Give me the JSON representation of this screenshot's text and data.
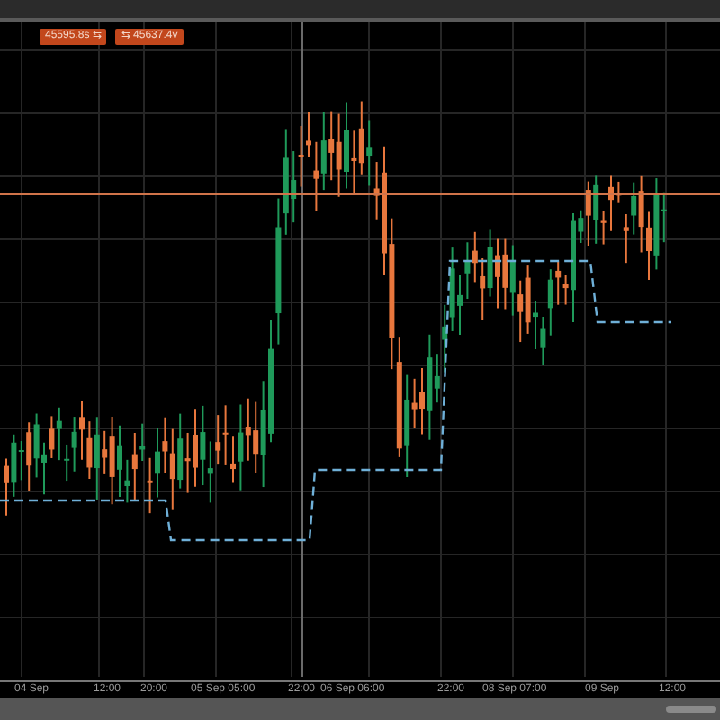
{
  "price_tags": [
    {
      "text": "45595.8s ⇆"
    },
    {
      "text": "⇆ 45637.4v"
    }
  ],
  "time_axis": [
    "04 Sep",
    "12:00",
    "20:00",
    "05 Sep 05:00",
    "22:00",
    "06 Sep 06:00",
    "22:00",
    "08 Sep 07:00",
    "09 Sep",
    "12:00"
  ]
}
